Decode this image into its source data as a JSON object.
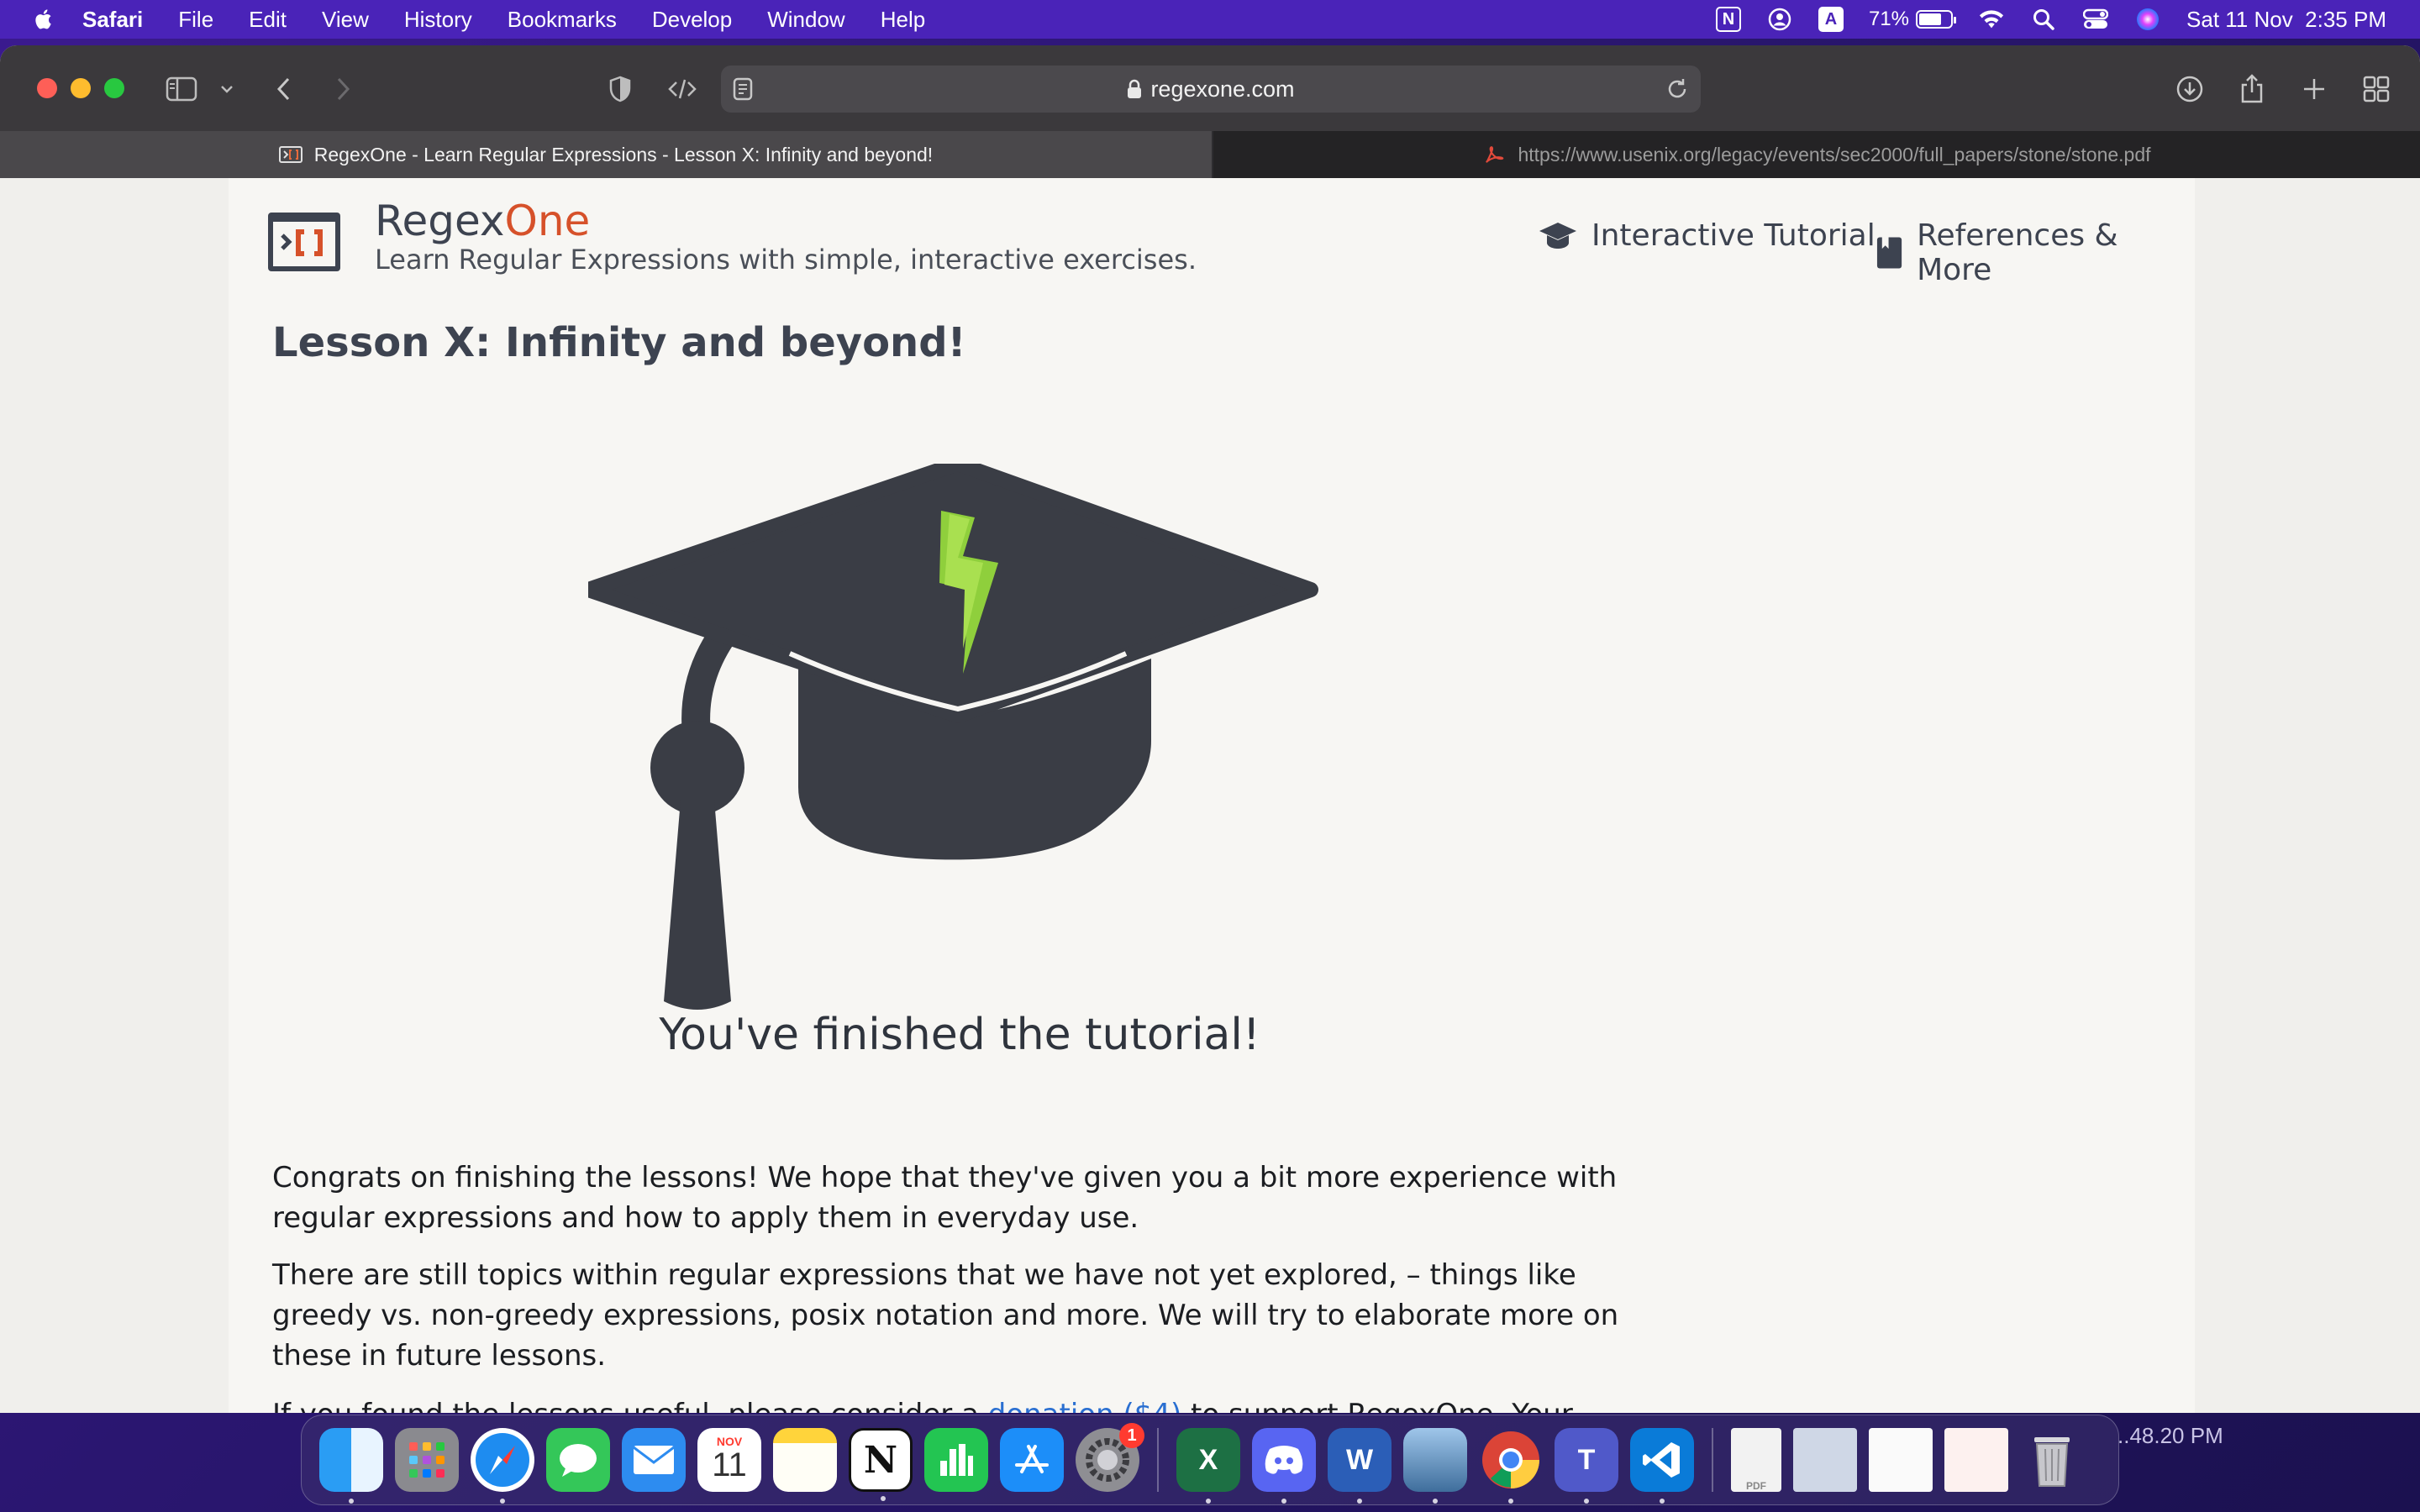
{
  "menubar": {
    "app_name": "Safari",
    "items": [
      "File",
      "Edit",
      "View",
      "History",
      "Bookmarks",
      "Develop",
      "Window",
      "Help"
    ],
    "battery_percent": "71%",
    "battery_level": 0.71,
    "datetime": "Sat 11 Nov  2:35 PM",
    "status_icons": [
      "notion-icon",
      "user-circle-icon",
      "input-source-icon",
      "battery-icon",
      "wifi-icon",
      "spotlight-icon",
      "control-center-icon",
      "siri-icon"
    ]
  },
  "browser": {
    "url": "regexone.com",
    "tabs": [
      {
        "title": "RegexOne - Learn Regular Expressions - Lesson X: Infinity and beyond!",
        "active": true
      },
      {
        "title": "https://www.usenix.org/legacy/events/sec2000/full_papers/stone/stone.pdf",
        "active": false
      }
    ]
  },
  "site": {
    "brand_regex": "Regex",
    "brand_one": "One",
    "tagline": "Learn Regular Expressions with simple, interactive exercises.",
    "nav": {
      "tutorial": "Interactive Tutorial",
      "references": "References & More"
    },
    "lesson_title": "Lesson X: Infinity and beyond!",
    "finished_heading": "You've finished the tutorial!",
    "paragraph1": "Congrats on finishing the lessons! We hope that they've given you a bit more experience with regular expressions and how to apply them in everyday use.",
    "paragraph2": "There are still topics within regular expressions that we have not yet explored, – things like greedy vs. non-greedy expressions, posix notation and more. We will try to elaborate more on these in future lessons.",
    "paragraph3_start": "If you found the lessons useful, please consider a ",
    "paragraph3_link": "donation ($4)",
    "paragraph3_end": " to support RegexOne. Your contribution will"
  },
  "dock": {
    "apps": [
      "finder",
      "launchpad",
      "safari",
      "messages",
      "mail",
      "calendar",
      "notes",
      "notion",
      "numbers",
      "app-store",
      "system-settings",
      "excel",
      "discord",
      "word",
      "preview",
      "chrome",
      "teams",
      "vscode"
    ],
    "calendar_month": "NOV",
    "calendar_day": "11",
    "settings_badge": "1",
    "desktop_label": "..48.20 PM"
  },
  "colors": {
    "menubar": "#4a23b8",
    "brand_accent": "#d6512a",
    "text_dark": "#3d4350",
    "link": "#2a6fd1"
  }
}
